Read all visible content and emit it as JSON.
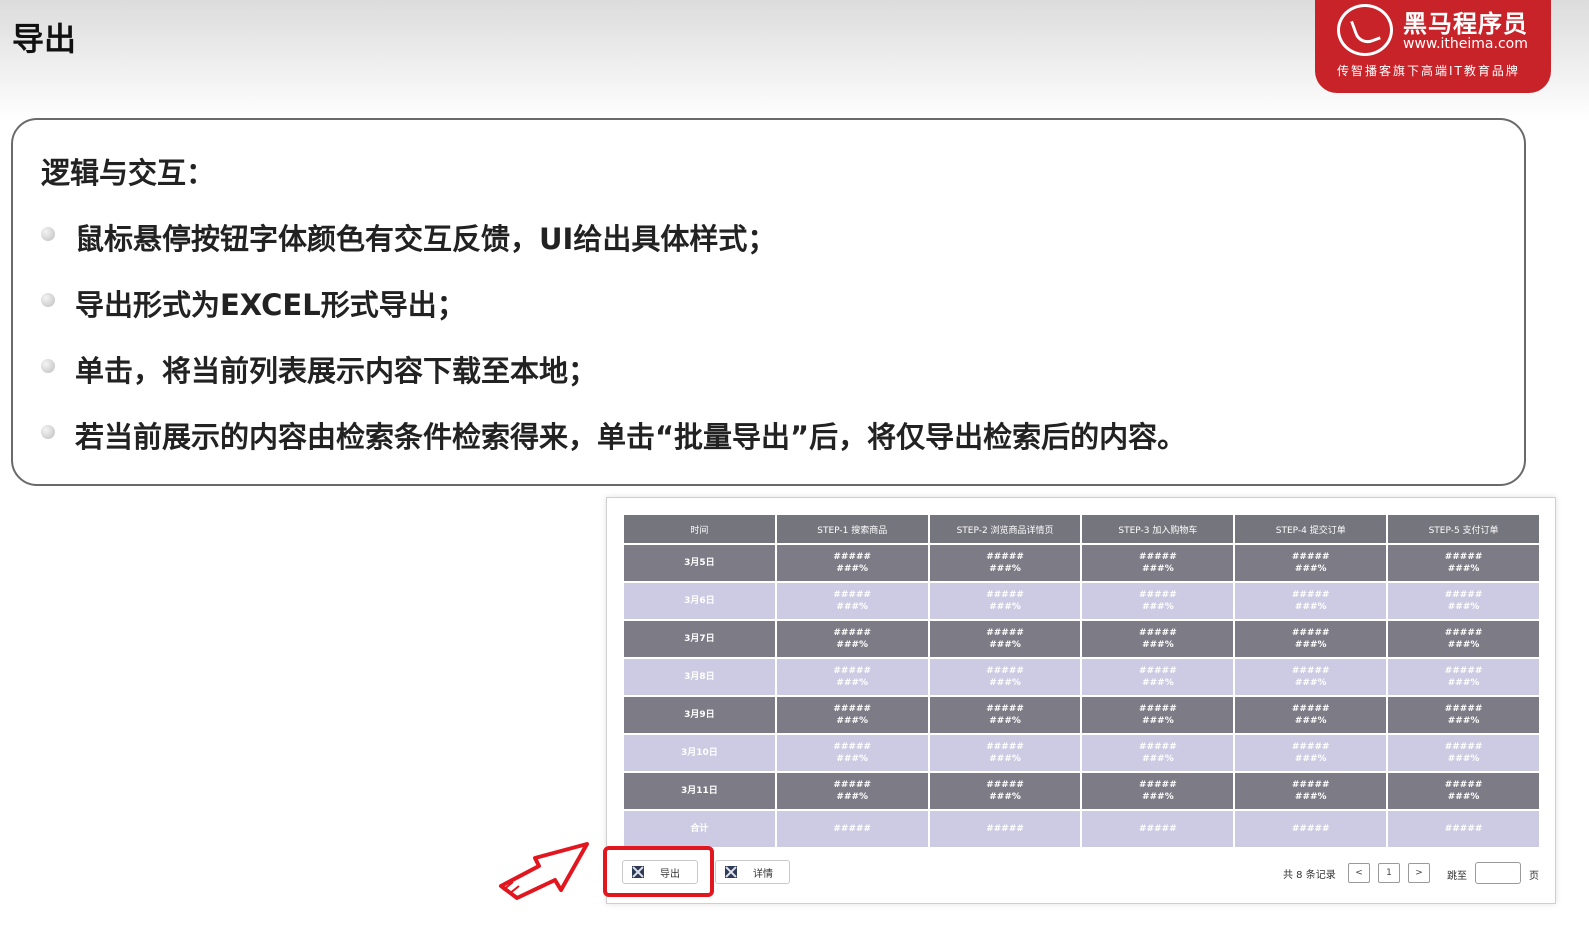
{
  "slide": {
    "title": "导出",
    "heading": "逻辑与交互：",
    "bullets": [
      "鼠标悬停按钮字体颜色有交互反馈，UI给出具体样式；",
      "导出形式为EXCEL形式导出；",
      "单击，将当前列表展示内容下载至本地；",
      "若当前展示的内容由检索条件检索得来，单击“批量导出”后，将仅导出检索后的内容。"
    ]
  },
  "logo": {
    "name": "黑马程序员",
    "url": "www.itheima.com",
    "slogan": "传智播客旗下高端IT教育品牌"
  },
  "table": {
    "headers": [
      "时间",
      "STEP-1 搜索商品",
      "STEP-2 浏览商品详情页",
      "STEP-3 加入购物车",
      "STEP-4 提交订单",
      "STEP-5 支付订单"
    ],
    "rows": [
      {
        "date": "3月5日",
        "count": "#####",
        "pct": "###%"
      },
      {
        "date": "3月6日",
        "count": "#####",
        "pct": "###%"
      },
      {
        "date": "3月7日",
        "count": "#####",
        "pct": "###%"
      },
      {
        "date": "3月8日",
        "count": "#####",
        "pct": "###%"
      },
      {
        "date": "3月9日",
        "count": "#####",
        "pct": "###%"
      },
      {
        "date": "3月10日",
        "count": "#####",
        "pct": "###%"
      },
      {
        "date": "3月11日",
        "count": "#####",
        "pct": "###%"
      }
    ],
    "total": {
      "label": "合计",
      "value": "#####"
    }
  },
  "buttons": {
    "export_label": "导出",
    "detail_label": "详情"
  },
  "pager": {
    "total_text": "共 8 条记录",
    "prev": "<",
    "current": "1",
    "next": ">",
    "jump_label": "跳至",
    "page_unit": "页"
  },
  "colors": {
    "header": "#75757e",
    "row_dark": "#7c7b86",
    "row_light": "#cdcbe4",
    "highlight": "#e2161f",
    "logo_red": "#c9232a"
  }
}
